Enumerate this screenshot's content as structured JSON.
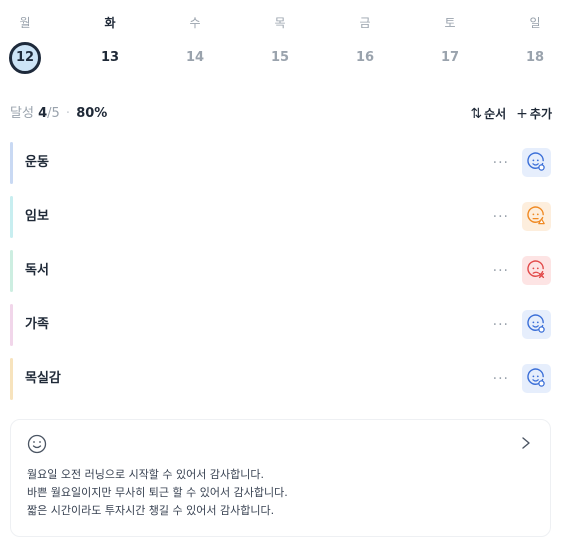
{
  "week": [
    {
      "name": "월",
      "num": "12",
      "selected": true
    },
    {
      "name": "화",
      "num": "13",
      "active": true
    },
    {
      "name": "수",
      "num": "14"
    },
    {
      "name": "목",
      "num": "15"
    },
    {
      "name": "금",
      "num": "16"
    },
    {
      "name": "토",
      "num": "17"
    },
    {
      "name": "일",
      "num": "18"
    }
  ],
  "summary": {
    "label": "달성",
    "done": "4",
    "total": "/5",
    "sep": "·",
    "percent": "80%"
  },
  "actions": {
    "order_icon": "⇅",
    "order_label": "순서",
    "add_icon": "+",
    "add_label": "추가"
  },
  "habits": [
    {
      "name": "운동",
      "bar_color": "#c9d9f3",
      "mood": "good",
      "mood_bg": "#e6eefc",
      "mood_color": "#3b6fd8"
    },
    {
      "name": "임보",
      "bar_color": "#c8eef0",
      "mood": "neutral",
      "mood_bg": "#fdeedd",
      "mood_color": "#f08a24"
    },
    {
      "name": "독서",
      "bar_color": "#cdeee1",
      "mood": "bad",
      "mood_bg": "#fde4e4",
      "mood_color": "#e24a4a"
    },
    {
      "name": "가족",
      "bar_color": "#f1d6ea",
      "mood": "good",
      "mood_bg": "#e6eefc",
      "mood_color": "#3b6fd8"
    },
    {
      "name": "목실감",
      "bar_color": "#f7e3bd",
      "mood": "good",
      "mood_bg": "#e6eefc",
      "mood_color": "#3b6fd8"
    }
  ],
  "more_label": "···",
  "gratitude": {
    "lines": [
      "월요일 오전 러닝으로 시작할 수 있어서 감사합니다.",
      "바쁜 월요일이지만 무사히 퇴근 할 수 있어서 감사합니다.",
      "짧은 시간이라도 투자시간 챙길 수 있어서 감사합니다."
    ]
  }
}
